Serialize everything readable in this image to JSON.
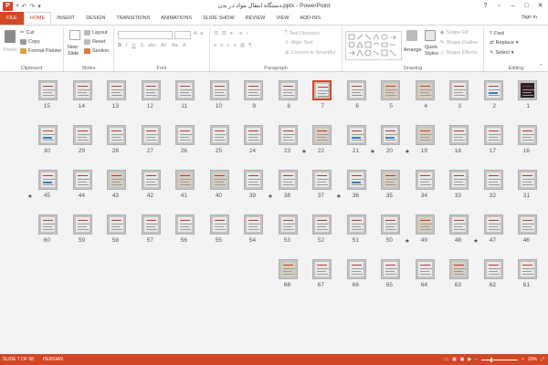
{
  "titlebar": {
    "app_letter": "P",
    "title": "دستگاه انتقال مواد در بدن.pptx - PowerPoint",
    "qat": [
      "save-icon",
      "undo-icon",
      "redo-icon",
      "customize-icon"
    ]
  },
  "tabs": [
    {
      "label": "FILE"
    },
    {
      "label": "HOME"
    },
    {
      "label": "INSERT"
    },
    {
      "label": "DESIGN"
    },
    {
      "label": "TRANSITIONS"
    },
    {
      "label": "ANIMATIONS"
    },
    {
      "label": "SLIDE SHOW"
    },
    {
      "label": "REVIEW"
    },
    {
      "label": "VIEW"
    },
    {
      "label": "ADD-INS"
    }
  ],
  "signin": "Sign in",
  "ribbon": {
    "clipboard": {
      "paste": "Paste",
      "cut": "Cut",
      "copy": "Copy",
      "format_painter": "Format Painter",
      "label": "Clipboard"
    },
    "slides": {
      "new_slide_line1": "New",
      "new_slide_line2": "Slide",
      "layout": "Layout",
      "reset": "Reset",
      "section": "Section",
      "label": "Slides"
    },
    "font": {
      "label": "Font"
    },
    "paragraph": {
      "text_direction": "Text Direction",
      "align_text": "Align Text",
      "convert_smartart": "Convert to SmartArt",
      "label": "Paragraph"
    },
    "drawing": {
      "arrange": "Arrange",
      "quick_styles_line1": "Quick",
      "quick_styles_line2": "Styles",
      "shape_fill": "Shape Fill",
      "shape_outline": "Shape Outline",
      "shape_effects": "Shape Effects",
      "label": "Drawing"
    },
    "editing": {
      "find": "Find",
      "replace": "Replace",
      "select": "Select",
      "label": "Editing"
    }
  },
  "slides": [
    {
      "n": "1"
    },
    {
      "n": "2"
    },
    {
      "n": "3"
    },
    {
      "n": "4"
    },
    {
      "n": "5"
    },
    {
      "n": "6"
    },
    {
      "n": "7"
    },
    {
      "n": "8"
    },
    {
      "n": "9"
    },
    {
      "n": "10"
    },
    {
      "n": "11"
    },
    {
      "n": "12"
    },
    {
      "n": "13"
    },
    {
      "n": "14"
    },
    {
      "n": "15"
    },
    {
      "n": "16"
    },
    {
      "n": "17"
    },
    {
      "n": "18"
    },
    {
      "n": "19",
      "star": "★"
    },
    {
      "n": "20",
      "star": "★"
    },
    {
      "n": "21"
    },
    {
      "n": "22",
      "star": "★"
    },
    {
      "n": "23"
    },
    {
      "n": "24"
    },
    {
      "n": "25"
    },
    {
      "n": "26"
    },
    {
      "n": "27"
    },
    {
      "n": "28"
    },
    {
      "n": "29"
    },
    {
      "n": "30"
    },
    {
      "n": "31"
    },
    {
      "n": "32"
    },
    {
      "n": "33"
    },
    {
      "n": "34"
    },
    {
      "n": "35"
    },
    {
      "n": "36",
      "star": "★"
    },
    {
      "n": "37"
    },
    {
      "n": "38",
      "star": "★"
    },
    {
      "n": "39"
    },
    {
      "n": "40"
    },
    {
      "n": "41"
    },
    {
      "n": "42"
    },
    {
      "n": "43"
    },
    {
      "n": "44"
    },
    {
      "n": "45",
      "star": "★"
    },
    {
      "n": "46"
    },
    {
      "n": "47",
      "star": "★"
    },
    {
      "n": "48"
    },
    {
      "n": "49",
      "star": "★"
    },
    {
      "n": "50"
    },
    {
      "n": "51"
    },
    {
      "n": "52"
    },
    {
      "n": "53"
    },
    {
      "n": "54"
    },
    {
      "n": "55"
    },
    {
      "n": "56"
    },
    {
      "n": "57"
    },
    {
      "n": "58"
    },
    {
      "n": "59"
    },
    {
      "n": "60"
    },
    {
      "n": "61"
    },
    {
      "n": "62"
    },
    {
      "n": "63"
    },
    {
      "n": "64"
    },
    {
      "n": "65"
    },
    {
      "n": "66"
    },
    {
      "n": "67"
    },
    {
      "n": "68"
    }
  ],
  "selected_slide": "7",
  "statusbar": {
    "slide_info": "SLIDE 7 OF 68",
    "language": "PERSIAN",
    "zoom": "20%"
  },
  "colors": {
    "accent": "#d24726",
    "selected_border": "#d24726"
  }
}
